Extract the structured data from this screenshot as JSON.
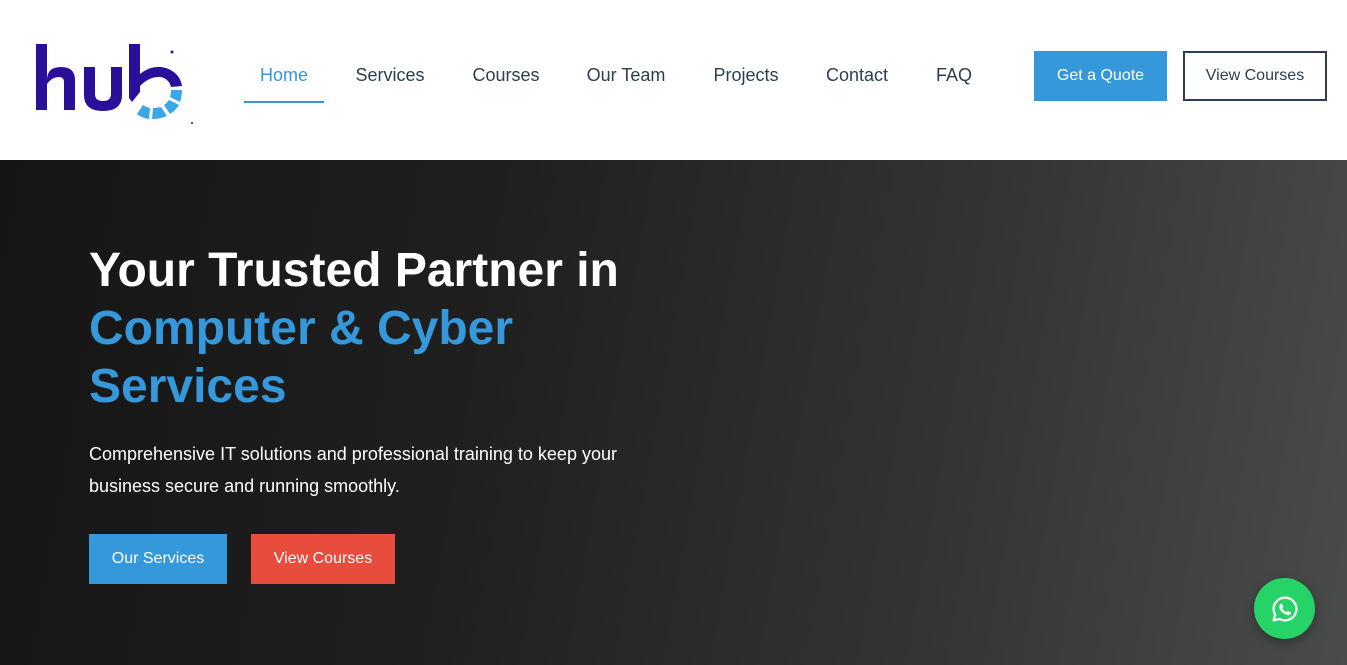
{
  "brand": {
    "logo_text": "hub",
    "colors": {
      "logo_main": "#2a0f9a",
      "logo_accent": "#3aa7e8"
    }
  },
  "nav": {
    "items": [
      {
        "label": "Home",
        "active": true
      },
      {
        "label": "Services",
        "active": false
      },
      {
        "label": "Courses",
        "active": false
      },
      {
        "label": "Our Team",
        "active": false
      },
      {
        "label": "Projects",
        "active": false
      },
      {
        "label": "Contact",
        "active": false
      },
      {
        "label": "FAQ",
        "active": false
      }
    ]
  },
  "header_actions": {
    "quote_label": "Get a Quote",
    "view_courses_label": "View Courses"
  },
  "hero": {
    "title_line1": "Your Trusted Partner in",
    "title_accent": "Computer & Cyber Services",
    "description": "Comprehensive IT solutions and professional training to keep your business secure and running smoothly.",
    "primary_button": "Our Services",
    "secondary_button": "View Courses"
  },
  "floating": {
    "icon": "whatsapp-icon"
  },
  "colors": {
    "accent_blue": "#3498db",
    "accent_red": "#e74c3c",
    "text_dark": "#2c3e50",
    "whatsapp_green": "#25d366"
  }
}
